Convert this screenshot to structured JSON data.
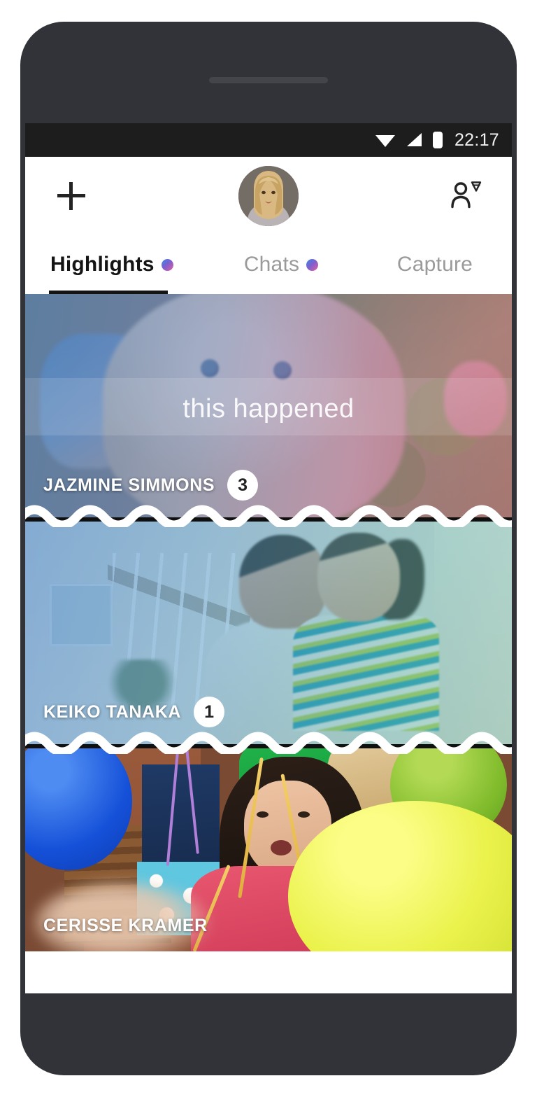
{
  "device": {
    "speaker_grille": "speaker-grille",
    "frame_color": "#313339"
  },
  "status_bar": {
    "time": "22:17",
    "icons": [
      "wifi-icon",
      "cellular-signal-icon",
      "battery-icon"
    ],
    "background": "#1d1d1d"
  },
  "header": {
    "add_label": "+",
    "add_icon": "plus-icon",
    "avatar_name": "profile-avatar",
    "contacts_icon": "add-contact-diamond-icon"
  },
  "tabs": [
    {
      "label": "Highlights",
      "active": true,
      "has_dot": true
    },
    {
      "label": "Chats",
      "active": false,
      "has_dot": true
    },
    {
      "label": "Capture",
      "active": false,
      "has_dot": false
    }
  ],
  "tab_dot_gradient": "#3b8ae0 → #e05fa0",
  "feed": {
    "overlay_caption": "this happened",
    "cards": [
      {
        "name": "JAZMINE SIMMONS",
        "count": "3",
        "has_count": true,
        "photo": "dog-on-trampoline",
        "tint": "blue-to-pink"
      },
      {
        "name": "KEIKO TANAKA",
        "count": "1",
        "has_count": true,
        "photo": "man-holding-child-on-stairs",
        "tint": "blue-to-teal"
      },
      {
        "name": "CERISSE KRAMER",
        "count": "",
        "has_count": false,
        "photo": "girl-at-birthday-party-with-balloons",
        "tint": "none"
      }
    ]
  }
}
